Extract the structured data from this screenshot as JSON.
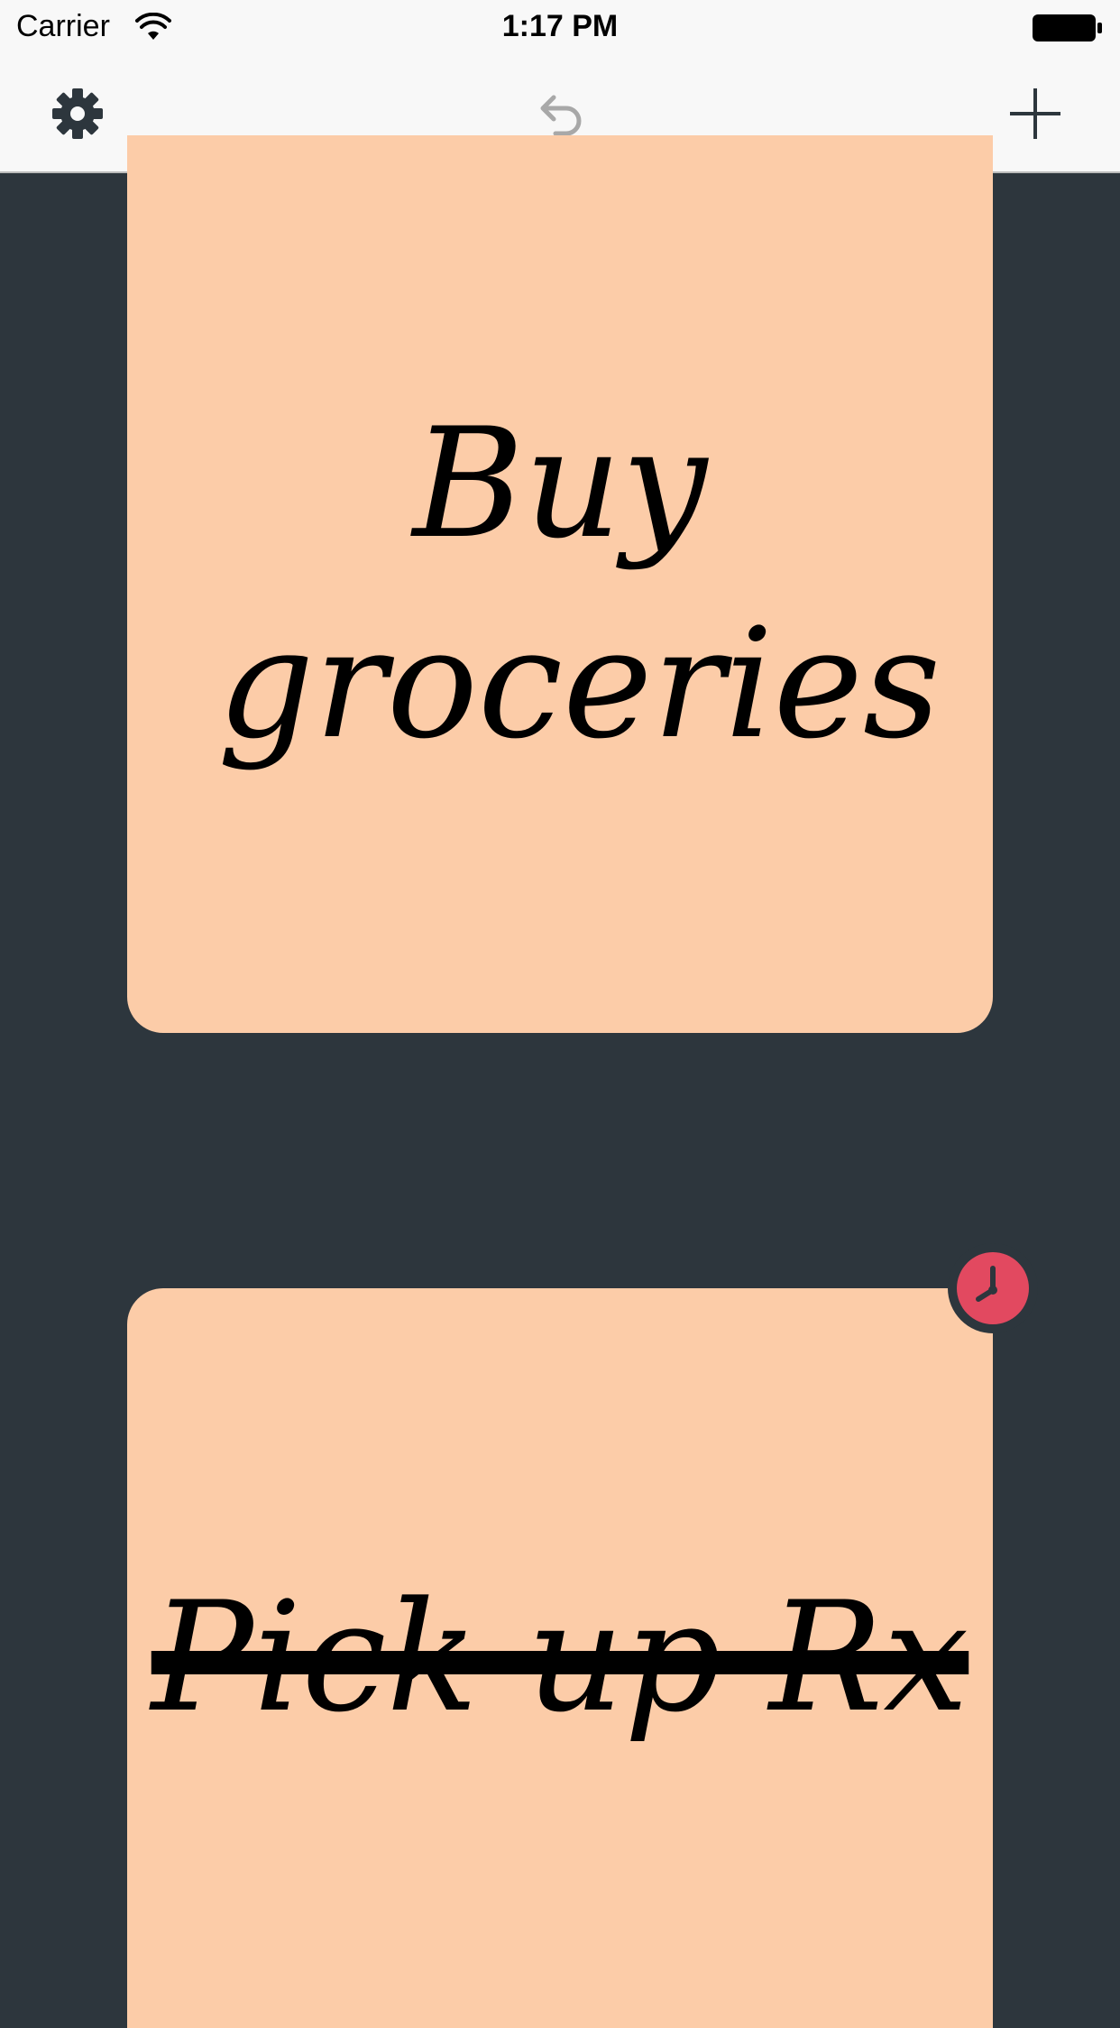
{
  "status_bar": {
    "carrier": "Carrier",
    "time": "1:17 PM",
    "icons": [
      "wifi-icon",
      "battery-icon"
    ]
  },
  "toolbar": {
    "left_icon": "gear-icon",
    "center_icon": "undo-icon",
    "right_icon": "plus-icon"
  },
  "colors": {
    "background": "#2d363d",
    "bar": "#f8f8f8",
    "card": "#fccca8",
    "alarm": "#e24960"
  },
  "cards": [
    {
      "text": "Buy groceries",
      "completed": false,
      "has_reminder": false
    },
    {
      "text": "Pick up Rx",
      "completed": true,
      "has_reminder": true,
      "reminder_icon": "clock-icon"
    }
  ]
}
